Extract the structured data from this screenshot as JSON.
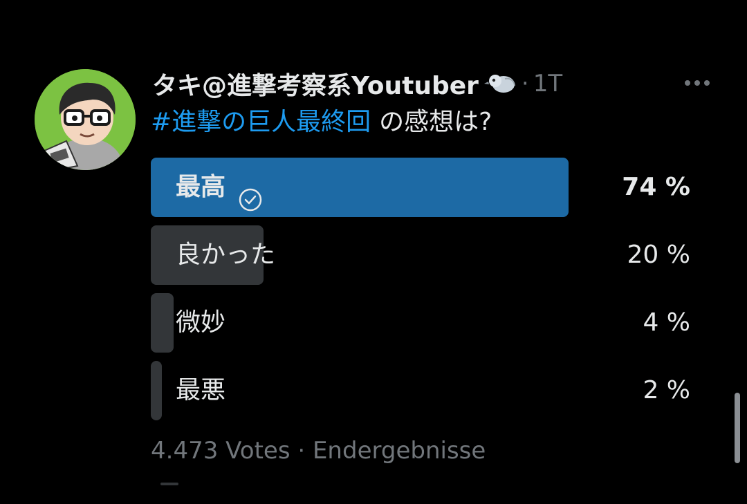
{
  "tweet": {
    "display_name": "タキ@進撃考察系Youtuber",
    "badge_icon": "bird-emoji-icon",
    "separator": "·",
    "time": "1T",
    "more_icon": "more-options-icon",
    "question_hashtag": "#進撃の巨人最終回",
    "question_text": "の感想は?"
  },
  "poll": {
    "options": [
      {
        "label": "最高",
        "percent_text": "74 %",
        "percent": 74,
        "winner": true,
        "icon": "check-circle-icon"
      },
      {
        "label": "良かった",
        "percent_text": "20 %",
        "percent": 20,
        "winner": false
      },
      {
        "label": "微妙",
        "percent_text": "4 %",
        "percent": 4,
        "winner": false
      },
      {
        "label": "最悪",
        "percent_text": "2 %",
        "percent": 2,
        "winner": false
      }
    ],
    "footer": "4.473 Votes · Endergebnisse"
  },
  "colors": {
    "background": "#000000",
    "hashtag": "#1d9bf0",
    "winner_bar": "#1d6aa5",
    "bar": "#333639",
    "secondary_text": "#71767b",
    "avatar_bg": "#7cc242"
  }
}
